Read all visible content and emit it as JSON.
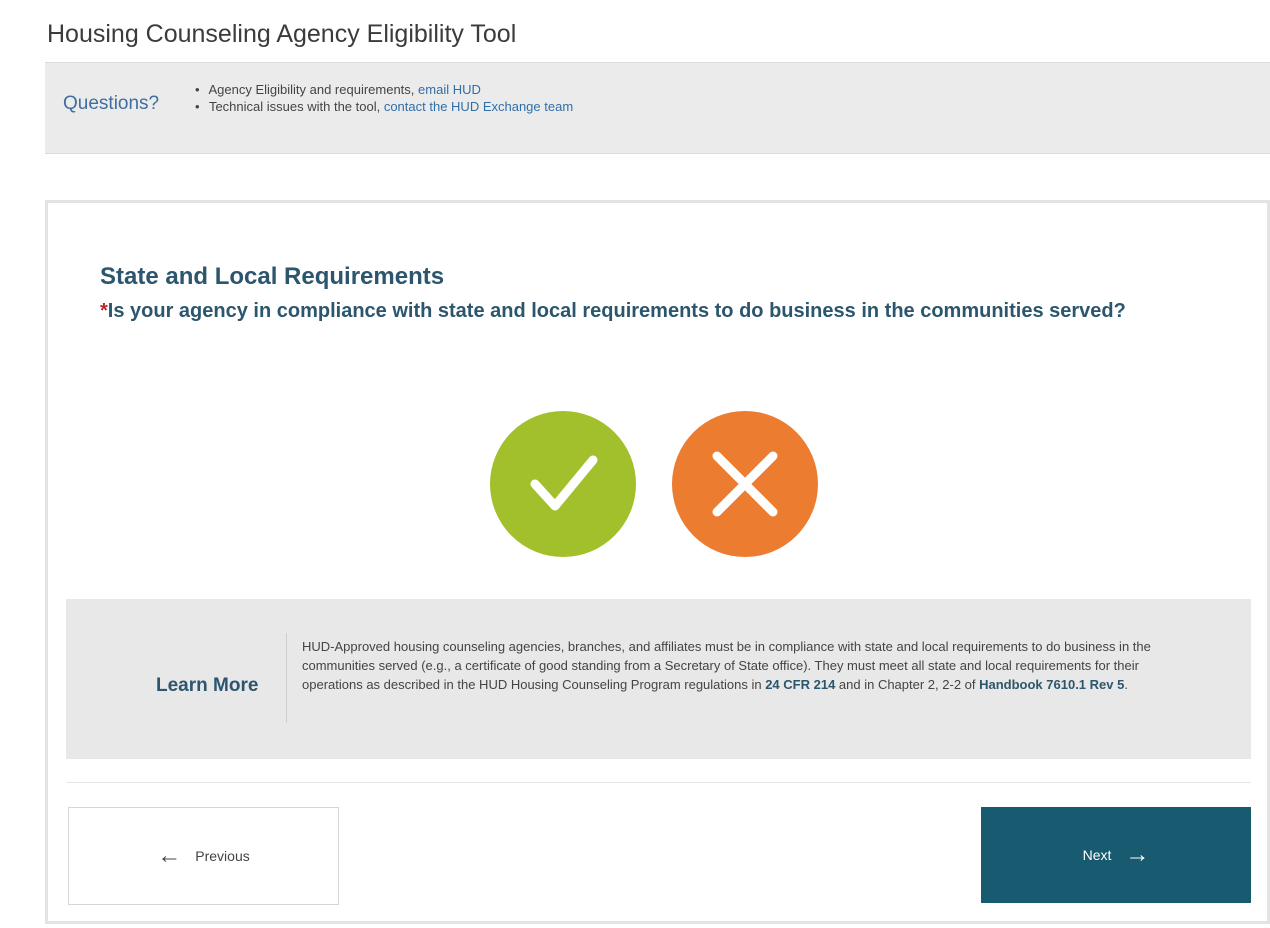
{
  "page": {
    "title": "Housing Counseling Agency Eligibility Tool"
  },
  "questions_bar": {
    "label": "Questions?",
    "items": [
      {
        "text": "Agency Eligibility and requirements, ",
        "link": "email HUD"
      },
      {
        "text": "Technical issues with the tool, ",
        "link": "contact the HUD Exchange team"
      }
    ]
  },
  "section": {
    "title": "State and Local Requirements",
    "required_marker": "*",
    "question": "Is your agency in compliance with state and local requirements to do business in the communities served?"
  },
  "answers": {
    "yes_icon": "checkmark-icon",
    "no_icon": "x-icon",
    "yes_color": "#a2c02b",
    "no_color": "#ec7c30"
  },
  "learn_more": {
    "label": "Learn More",
    "text_1": "HUD-Approved housing counseling agencies, branches, and affiliates must be in compliance with state and local requirements to do business in the communities served (e.g., a certificate of good standing from a Secretary of State office). They must meet all state and local requirements for their operations as described in the HUD Housing Counseling Program regulations in ",
    "link_1": "24 CFR 214",
    "text_2": " and in Chapter 2, 2-2 of ",
    "link_2": "Handbook 7610.1 Rev 5",
    "text_3": "."
  },
  "nav": {
    "previous_label": "Previous",
    "next_label": "Next",
    "next_color": "#185a6f"
  }
}
